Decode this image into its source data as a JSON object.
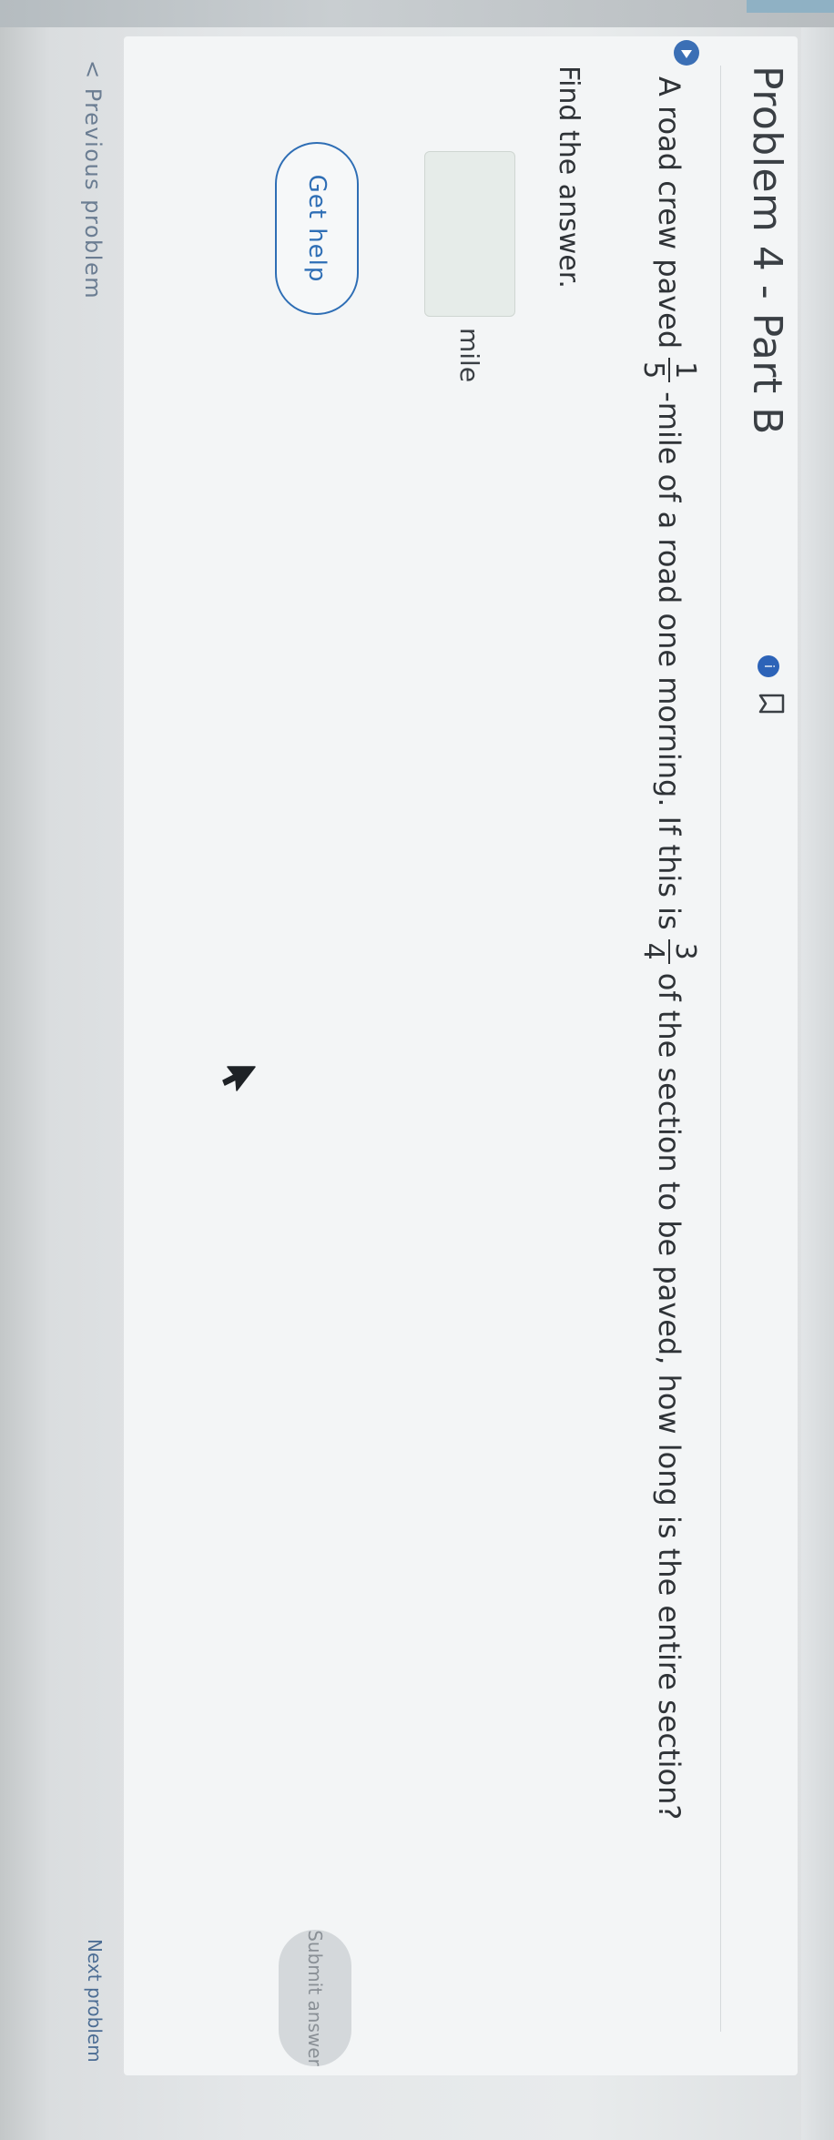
{
  "problem": {
    "title": "Problem 4 - Part B",
    "status_icon": "info-dot-icon",
    "bookmark_icon": "bookmark-icon"
  },
  "question": {
    "audio_icon": "play-audio-icon",
    "text_before": "A road crew paved",
    "fraction_1": {
      "numerator": "1",
      "denominator": "5"
    },
    "text_middle": "-mile of a road one morning. If this is",
    "fraction_2": {
      "numerator": "3",
      "denominator": "4"
    },
    "text_after": "of the section to be paved, how long is the entire section?"
  },
  "instruction": "Find the answer.",
  "answer": {
    "value": "",
    "unit": "mile"
  },
  "buttons": {
    "get_help": "Get help",
    "submit": "Submit answer"
  },
  "navigation": {
    "previous": "< Previous problem",
    "next": "Next problem"
  },
  "colors": {
    "accent": "#2e6eb5",
    "text": "#2f3337",
    "card": "#f3f5f6"
  }
}
